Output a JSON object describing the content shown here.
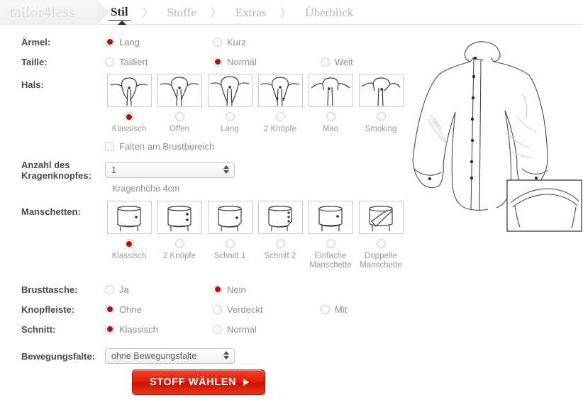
{
  "brand": {
    "logo_text": "tailor4less"
  },
  "nav": {
    "separator": "〉",
    "items": [
      {
        "label": "Stil",
        "active": true
      },
      {
        "label": "Stoffe",
        "active": false
      },
      {
        "label": "Extras",
        "active": false
      },
      {
        "label": "Überblick",
        "active": false
      }
    ]
  },
  "accent_color": "#b60d0d",
  "cta_color": "#e01b0d",
  "form": {
    "sleeve": {
      "label": "Ärmel:",
      "options": [
        {
          "label": "Lang",
          "selected": true
        },
        {
          "label": "Kurz",
          "selected": false
        }
      ]
    },
    "waist": {
      "label": "Taille:",
      "options": [
        {
          "label": "Tailliert",
          "selected": false
        },
        {
          "label": "Normal",
          "selected": true
        },
        {
          "label": "Weit",
          "selected": false
        }
      ]
    },
    "collar": {
      "label": "Hals:",
      "options": [
        {
          "label": "Klassisch",
          "selected": true,
          "icon": "collar-classic-icon"
        },
        {
          "label": "Offen",
          "selected": false,
          "icon": "collar-open-icon"
        },
        {
          "label": "Lang",
          "selected": false,
          "icon": "collar-long-icon"
        },
        {
          "label": "2 Knöpfe",
          "selected": false,
          "icon": "collar-two-button-icon"
        },
        {
          "label": "Mao",
          "selected": false,
          "icon": "collar-mao-icon"
        },
        {
          "label": "Smoking",
          "selected": false,
          "icon": "collar-tuxedo-icon"
        }
      ]
    },
    "chest_pleat": {
      "label": "Falten am Brustbereich",
      "checked": false
    },
    "collar_buttons": {
      "label_line1": "Anzahl des",
      "label_line2": "Kragenknopfes:",
      "value": "1",
      "note": "Kragenhöhe 4cm"
    },
    "cuffs": {
      "label": "Manschetten:",
      "options": [
        {
          "label": "Klassisch",
          "selected": true,
          "icon": "cuff-classic-icon"
        },
        {
          "label": "2 Knöpfe",
          "selected": false,
          "icon": "cuff-two-button-icon"
        },
        {
          "label": "Schnitt 1",
          "selected": false,
          "icon": "cuff-cut1-icon"
        },
        {
          "label": "Schnitt 2",
          "selected": false,
          "icon": "cuff-cut2-icon"
        },
        {
          "label": "Einfache Manschette",
          "selected": false,
          "icon": "cuff-single-icon"
        },
        {
          "label": "Doppelte Manschette",
          "selected": false,
          "icon": "cuff-double-icon"
        }
      ]
    },
    "chest_pocket": {
      "label": "Brusttasche:",
      "options": [
        {
          "label": "Ja",
          "selected": false
        },
        {
          "label": "Nein",
          "selected": true
        }
      ]
    },
    "placket": {
      "label": "Knopfleiste:",
      "options": [
        {
          "label": "Ohne",
          "selected": true
        },
        {
          "label": "Verdeckt",
          "selected": false
        },
        {
          "label": "Mit",
          "selected": false
        }
      ]
    },
    "fit": {
      "label": "Schnitt:",
      "options": [
        {
          "label": "Klassisch",
          "selected": true
        },
        {
          "label": "Normal",
          "selected": false
        }
      ]
    },
    "back_pleat": {
      "label": "Bewegungsfalte:",
      "value": "ohne Bewegungsfalte"
    }
  },
  "cta": {
    "label": "STOFF WÄHLEN"
  },
  "preview": {
    "alt": "shirt-line-drawing"
  }
}
